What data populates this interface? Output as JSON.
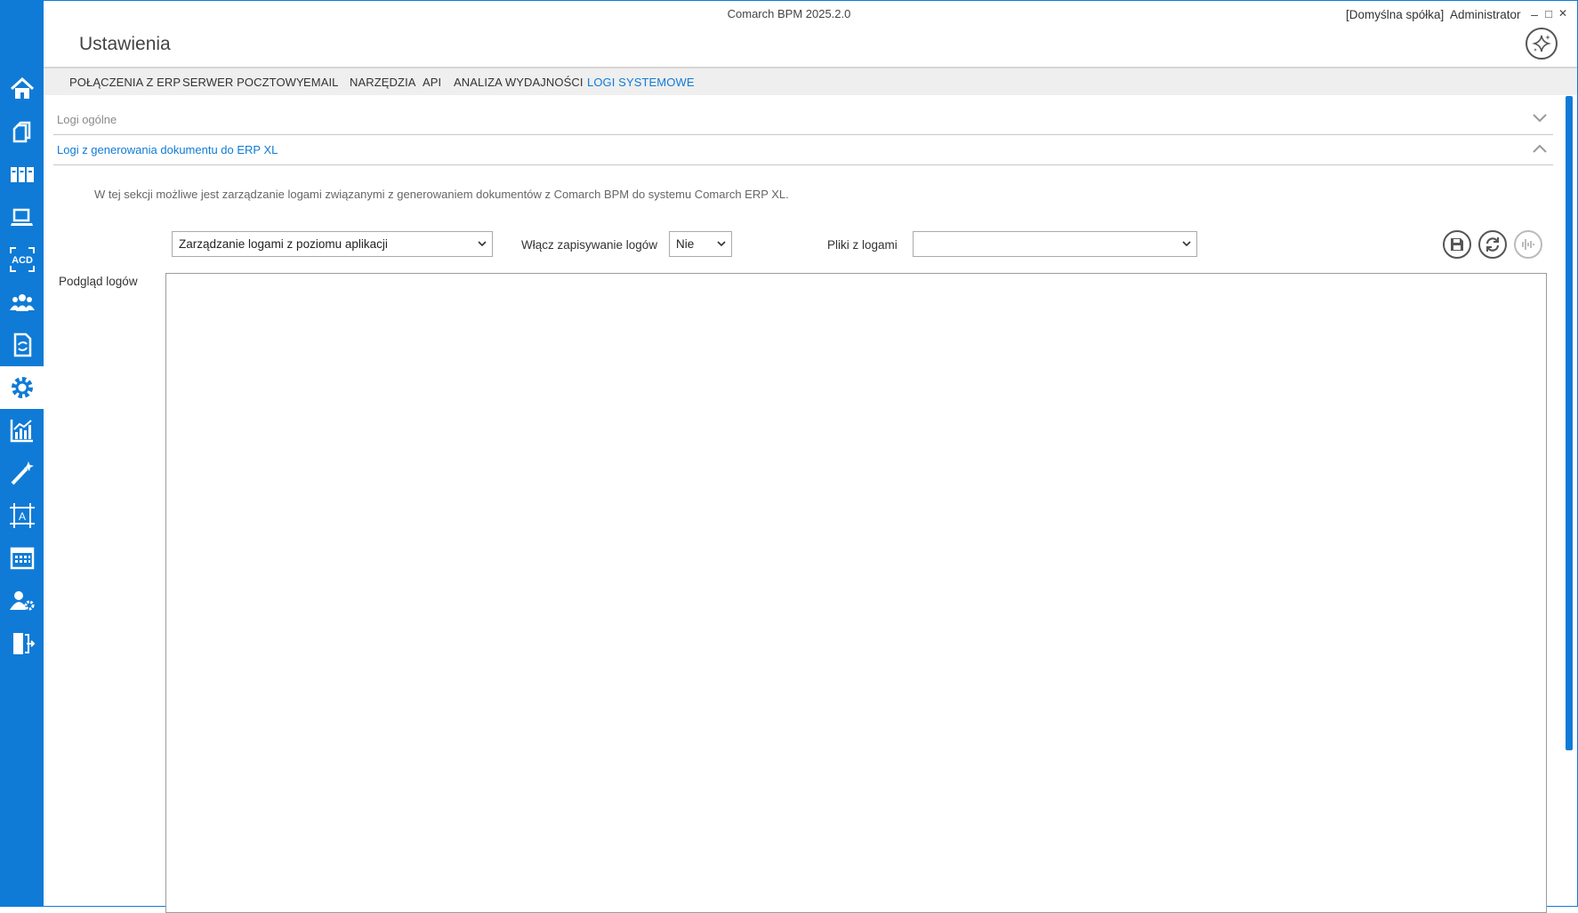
{
  "window": {
    "app_title": "Comarch BPM 2025.2.0",
    "company": "[Domyślna spółka]",
    "user": "Administrator",
    "minimize": "–",
    "maximize": "□",
    "close": "✕"
  },
  "page": {
    "title": "Ustawienia"
  },
  "tabs": [
    {
      "label": "POŁĄCZENIA Z ERP",
      "active": false
    },
    {
      "label": "SERWER POCZTOWY",
      "active": false
    },
    {
      "label": "EMAIL",
      "active": false
    },
    {
      "label": "NARZĘDZIA",
      "active": false
    },
    {
      "label": "API",
      "active": false
    },
    {
      "label": "ANALIZA WYDAJNOŚCI",
      "active": false
    },
    {
      "label": "LOGI SYSTEMOWE",
      "active": true
    }
  ],
  "sidebar": {
    "items": [
      {
        "icon": "home-icon"
      },
      {
        "icon": "documents-icon"
      },
      {
        "icon": "binders-icon"
      },
      {
        "icon": "laptop-icon"
      },
      {
        "icon": "acd-icon",
        "text": "ACD"
      },
      {
        "icon": "users-icon"
      },
      {
        "icon": "document-sync-icon"
      },
      {
        "icon": "gear-icon",
        "active": true
      },
      {
        "icon": "chart-icon"
      },
      {
        "icon": "magic-wand-icon"
      },
      {
        "icon": "designer-icon",
        "text": "A"
      },
      {
        "icon": "calendar-icon"
      },
      {
        "icon": "user-settings-icon"
      },
      {
        "icon": "logout-icon"
      }
    ]
  },
  "sections": {
    "general": {
      "title": "Logi ogólne",
      "expanded": false
    },
    "erp_xl": {
      "title": "Logi z generowania dokumentu do ERP XL",
      "expanded": true
    }
  },
  "content": {
    "description": "W tej sekcji możliwe jest zarządzanie logami związanymi z generowaniem dokumentów z  Comarch BPM do systemu Comarch ERP XL.",
    "mode_select": {
      "value": "Zarządzanie logami z poziomu aplikacji"
    },
    "enable_logging": {
      "label": "Włącz zapisywanie logów",
      "value": "Nie"
    },
    "log_files": {
      "label": "Pliki z logami",
      "value": ""
    },
    "preview_label": "Podgląd logów",
    "preview_text": ""
  },
  "colors": {
    "accent": "#0f7bd6",
    "tabs_bg": "#efefef",
    "border": "#c8c8c8"
  }
}
